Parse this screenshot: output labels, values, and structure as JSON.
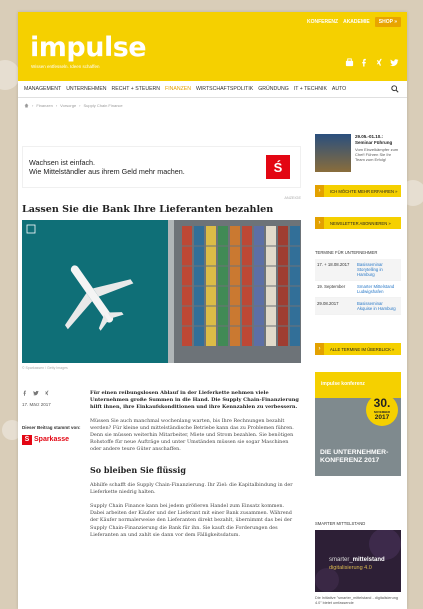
{
  "colors": {
    "brand_yellow": "#f5d000",
    "accent": "#e3a100",
    "sparkasse_red": "#e30613",
    "link_blue": "#2878c7"
  },
  "header": {
    "links": [
      "KONFERENZ",
      "AKADEMIE"
    ],
    "shop_label": "SHOP »",
    "logo": "impulse",
    "tagline": "Wissen entfesseln. Ideen schaffen",
    "socials": [
      "app-icon",
      "facebook-icon",
      "xing-icon",
      "twitter-icon"
    ]
  },
  "nav": {
    "items": [
      "MANAGEMENT",
      "UNTERNEHMEN",
      "RECHT + STEUERN",
      "FINANZEN",
      "WIRTSCHAFTSPOLITIK",
      "GRÜNDUNG",
      "IT + TECHNIK",
      "AUTO"
    ],
    "active_index": 3
  },
  "breadcrumb": [
    "Finanzen",
    "Vorsorge",
    "Supply Chain Finance"
  ],
  "banner": {
    "line1": "Wachsen ist einfach.",
    "line2": "Wie Mittelständler aus ihrem Geld mehr machen.",
    "logo_glyph": "Ś",
    "label": "ANZEIGE"
  },
  "article": {
    "headline": "Lassen Sie die Bank Ihre Lieferanten bezahlen",
    "image_caption": "© Sparkassen / Getty Images",
    "date": "17. März 2017",
    "sponsor_label": "Dieser Beitrag stammt von:",
    "sponsor_name": "Sparkasse",
    "lead": "Für einen reibungslosen Ablauf in der Lieferkette nehmen viele Unternehmen große Summen in die Hand. Die Supply Chain-Finanzierung hilft ihnen, ihre Einkaufskonditionen und ihre Kennzahlen zu verbessern.",
    "para1": "Müssen Sie auch manchmal wochenlang warten, bis Ihre Rechnungen bezahlt werden? Für kleine und mittelständische Betriebe kann das zu Problemen führen. Denn sie müssen weiterhin Mitarbeiter, Miete und Strom bezahlen. Sie benötigen Rohstoffe für neue Aufträge und unter Umständen müssen sie sogar Maschinen oder andere teure Güter anschaffen.",
    "subhead": "So bleiben Sie flüssig",
    "para2": "Abhilfe schafft die Supply Chain-Finanzierung. Ihr Ziel: die Kapitalbindung in der Lieferkette niedrig halten.",
    "para3": "Supply Chain Finance kann bei jedem größeren Handel zum Einsatz kommen. Dabei arbeiten der Käufer und der Lieferant mit einer Bank zusammen. Während der Käufer normalerweise den Lieferanten direkt bezahlt, übernimmt das bei der Supply Chain-Finanzierung die Bank für ihn. Sie kauft die Forderungen des Lieferanten an und zahlt sie dann vor dem Fälligkeitsdatum."
  },
  "sidebar": {
    "seminar": {
      "title": "29.05.-01.10.: Seminar Führung",
      "desc": "Vom Einzelkämpfer zum Chef! Führen Sie Ihr Team zum Erfolg!",
      "button": "ICH MÖCHTE MEHR ERFAHREN »"
    },
    "newsletter_button": "NEWSLETTER ABONNIEREN »",
    "termine_heading": "TERMINE FÜR UNTERNEHMER",
    "termine": [
      {
        "date": "17. + 18.08.2017",
        "title": "Basisseminar Storytelling in Hamburg"
      },
      {
        "date": "19. September",
        "title": "Smarter Mittelstand Ludwigshafen"
      },
      {
        "date": "29.08.2017",
        "title": "Basisseminar Akquise in Hamburg"
      }
    ],
    "termine_button": "ALLE TERMINE IM ÜBERBLICK »",
    "konferenz": {
      "logo": "impulse konferenz",
      "day": "30.",
      "month": "NOVEMBER",
      "year": "2017",
      "title": "DIE UNTERNEHMER-KONFERENZ 2017"
    },
    "smarter_heading": "SMARTER MITTELSTAND",
    "smarter_line1a": "smarter_",
    "smarter_line1b": "mittelstand",
    "smarter_line2": "digitalisierung 4.0",
    "smarter_desc": "Die Initiative \"smarter_mittelstand - digitalisierung 4.0\" bietet umfassende"
  }
}
